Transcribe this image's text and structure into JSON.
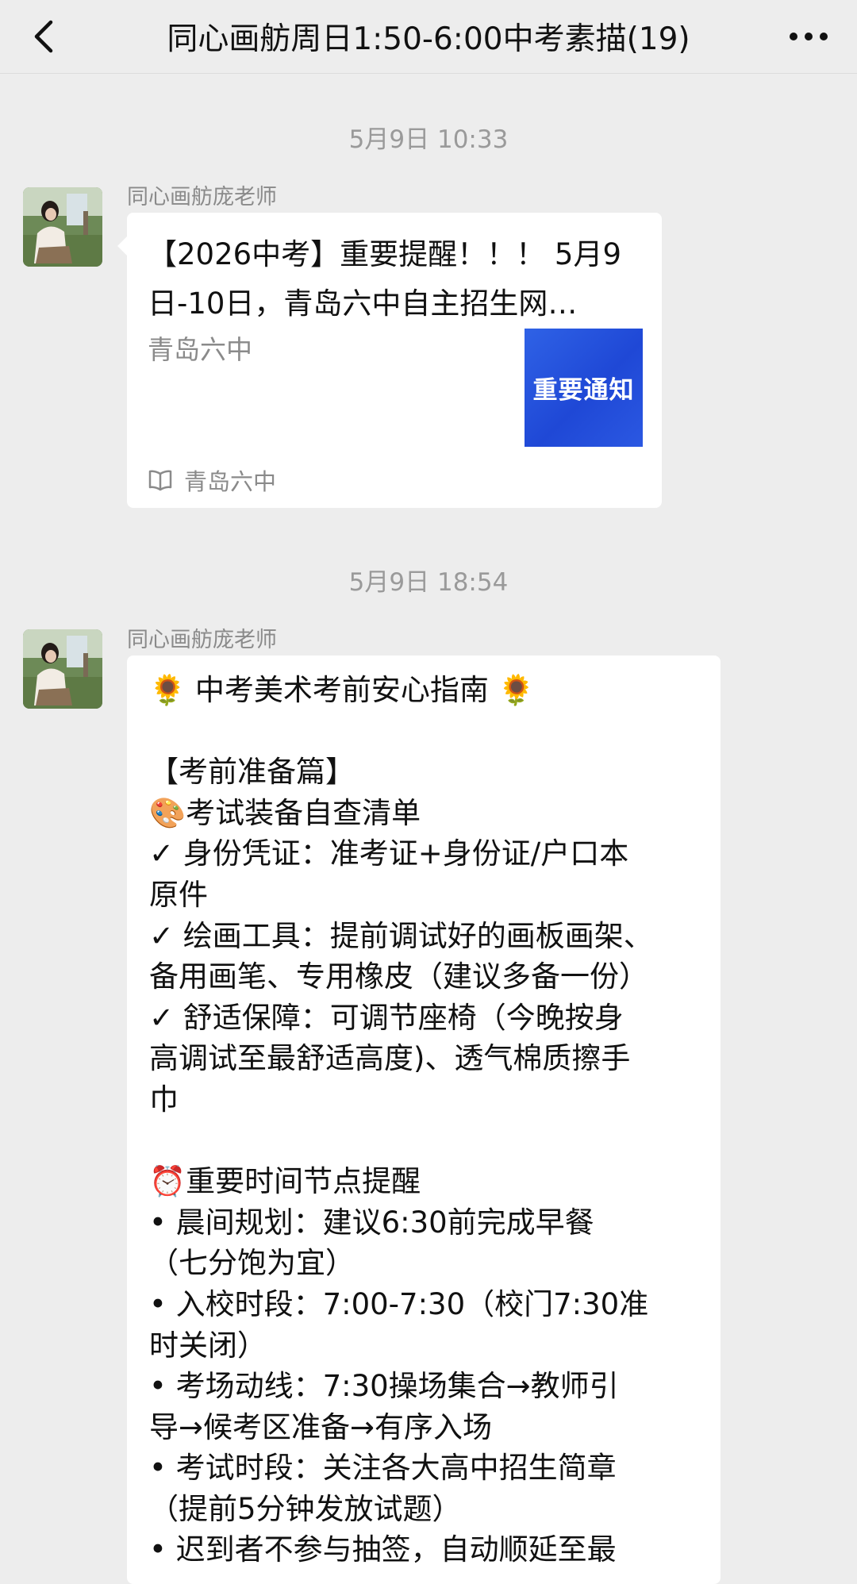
{
  "header": {
    "title": "同心画舫周日1:50-6:00中考素描(19)",
    "back_icon": "chevron-left-icon",
    "more_icon": "ellipsis-icon"
  },
  "messages": [
    {
      "time": "5月9日 10:33",
      "sender": "同心画舫庞老师",
      "type": "link-card",
      "card": {
        "title_line1": "【2026中考】重要提醒！！！ 5月9",
        "title_line2": "日-10日，青岛六中自主招生网…",
        "desc": "青岛六中",
        "thumb_text": "重要通知",
        "source": "青岛六中",
        "source_icon": "book-icon"
      }
    },
    {
      "time": "5月9日 18:54",
      "sender": "同心画舫庞老师",
      "type": "text",
      "lines": [
        "🌻 中考美术考前安心指南 🌻",
        "",
        "【考前准备篇】",
        "🎨考试装备自查清单",
        "✓ 身份凭证：准考证+身份证/户口本",
        "原件",
        "✓ 绘画工具：提前调试好的画板画架、",
        "备用画笔、专用橡皮（建议多备一份）",
        "✓ 舒适保障：可调节座椅（今晚按身",
        "高调试至最舒适高度)、透气棉质擦手",
        "巾",
        "",
        "⏰重要时间节点提醒",
        "• 晨间规划：建议6:30前完成早餐",
        "（七分饱为宜）",
        "• 入校时段：7:00-7:30（校门7:30准",
        "时关闭）",
        "• 考场动线：7:30操场集合→教师引",
        "导→候考区准备→有序入场",
        "• 考试时段：关注各大高中招生简章",
        "（提前5分钟发放试题）",
        "• 迟到者不参与抽签，自动顺延至最"
      ]
    }
  ],
  "colors": {
    "background": "#ededed",
    "bubble": "#ffffff",
    "secondary_text": "#8a8a8a",
    "timestamp_text": "#9a9a9a",
    "thumb_blue": "#2a55e0"
  }
}
